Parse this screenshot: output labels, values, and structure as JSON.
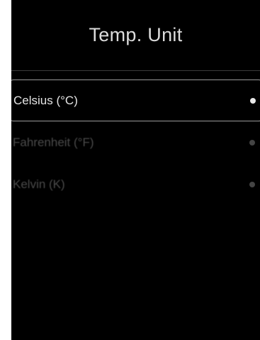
{
  "screen": {
    "title": "Temp. Unit"
  },
  "options": [
    {
      "label": "Celsius (°C)",
      "selected": true
    },
    {
      "label": "Fahrenheit (°F)",
      "selected": false
    },
    {
      "label": "Kelvin (K)",
      "selected": false
    }
  ],
  "colors": {
    "background": "#000000",
    "selected_text": "#e4e4e4",
    "unselected_text": "#4a4a4a",
    "highlight_border": "#9a9a9a"
  }
}
